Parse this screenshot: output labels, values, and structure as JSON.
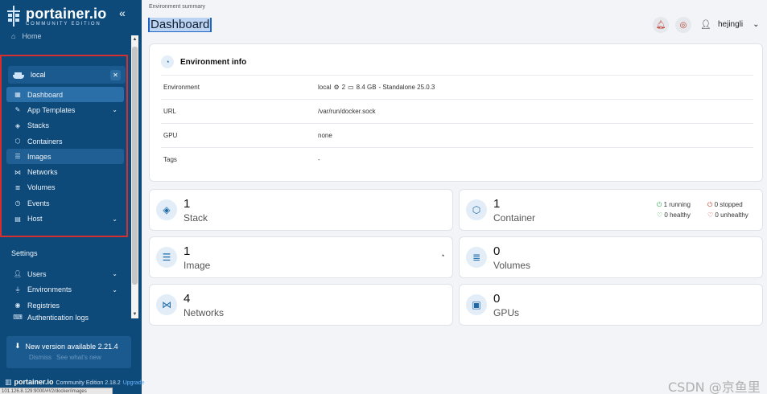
{
  "sidebar": {
    "brand_name": "portainer.io",
    "brand_sub": "COMMUNITY EDITION",
    "home_label": "Home",
    "environment": {
      "name": "local"
    },
    "env_nav": [
      {
        "label": "Dashboard",
        "icon": "dashboard-icon",
        "active": true
      },
      {
        "label": "App Templates",
        "icon": "edit-icon",
        "has_chevron": true
      },
      {
        "label": "Stacks",
        "icon": "stacks-icon"
      },
      {
        "label": "Containers",
        "icon": "cube-icon"
      },
      {
        "label": "Images",
        "icon": "list-icon",
        "highlighted": true
      },
      {
        "label": "Networks",
        "icon": "network-icon"
      },
      {
        "label": "Volumes",
        "icon": "database-icon"
      },
      {
        "label": "Events",
        "icon": "clock-icon"
      },
      {
        "label": "Host",
        "icon": "server-icon",
        "has_chevron": true
      }
    ],
    "settings_label": "Settings",
    "settings_nav": [
      {
        "label": "Users",
        "icon": "users-icon",
        "has_chevron": true
      },
      {
        "label": "Environments",
        "icon": "plug-icon",
        "has_chevron": true
      },
      {
        "label": "Registries",
        "icon": "radio-icon"
      },
      {
        "label": "Authentication logs",
        "icon": "log-icon"
      }
    ],
    "update": {
      "title": "New version available 2.21.4",
      "dismiss": "Dismiss",
      "whats_new": "See what's new"
    },
    "footer": {
      "name": "portainer.io",
      "edition": "Community Edition 2.18.2",
      "upgrade": "Upgrade"
    },
    "status_url": "101.126.8.129:9000/#!/2/docker/images"
  },
  "header": {
    "breadcrumb": "Environment summary",
    "title": "Dashboard",
    "username": "hejingli"
  },
  "env_info": {
    "title": "Environment info",
    "rows": [
      {
        "key": "Environment",
        "value": "local",
        "cpu": "2",
        "memory": "8.4 GB",
        "mode": "- Standalone 25.0.3"
      },
      {
        "key": "URL",
        "value": "/var/run/docker.sock"
      },
      {
        "key": "GPU",
        "value": "none"
      },
      {
        "key": "Tags",
        "value": "-"
      }
    ]
  },
  "stats": {
    "stack": {
      "count": "1",
      "label": "Stack"
    },
    "container": {
      "count": "1",
      "label": "Container",
      "running": "1 running",
      "stopped": "0 stopped",
      "healthy": "0 healthy",
      "unhealthy": "0 unhealthy"
    },
    "image": {
      "count": "1",
      "label": "Image"
    },
    "volumes": {
      "count": "0",
      "label": "Volumes"
    },
    "networks": {
      "count": "4",
      "label": "Networks"
    },
    "gpus": {
      "count": "0",
      "label": "GPUs"
    }
  },
  "watermark": "CSDN @京鱼里",
  "colors": {
    "sidebar": "#0d4a7a",
    "accent": "#1b6aa8",
    "highlight_box": "#d62f2f"
  }
}
